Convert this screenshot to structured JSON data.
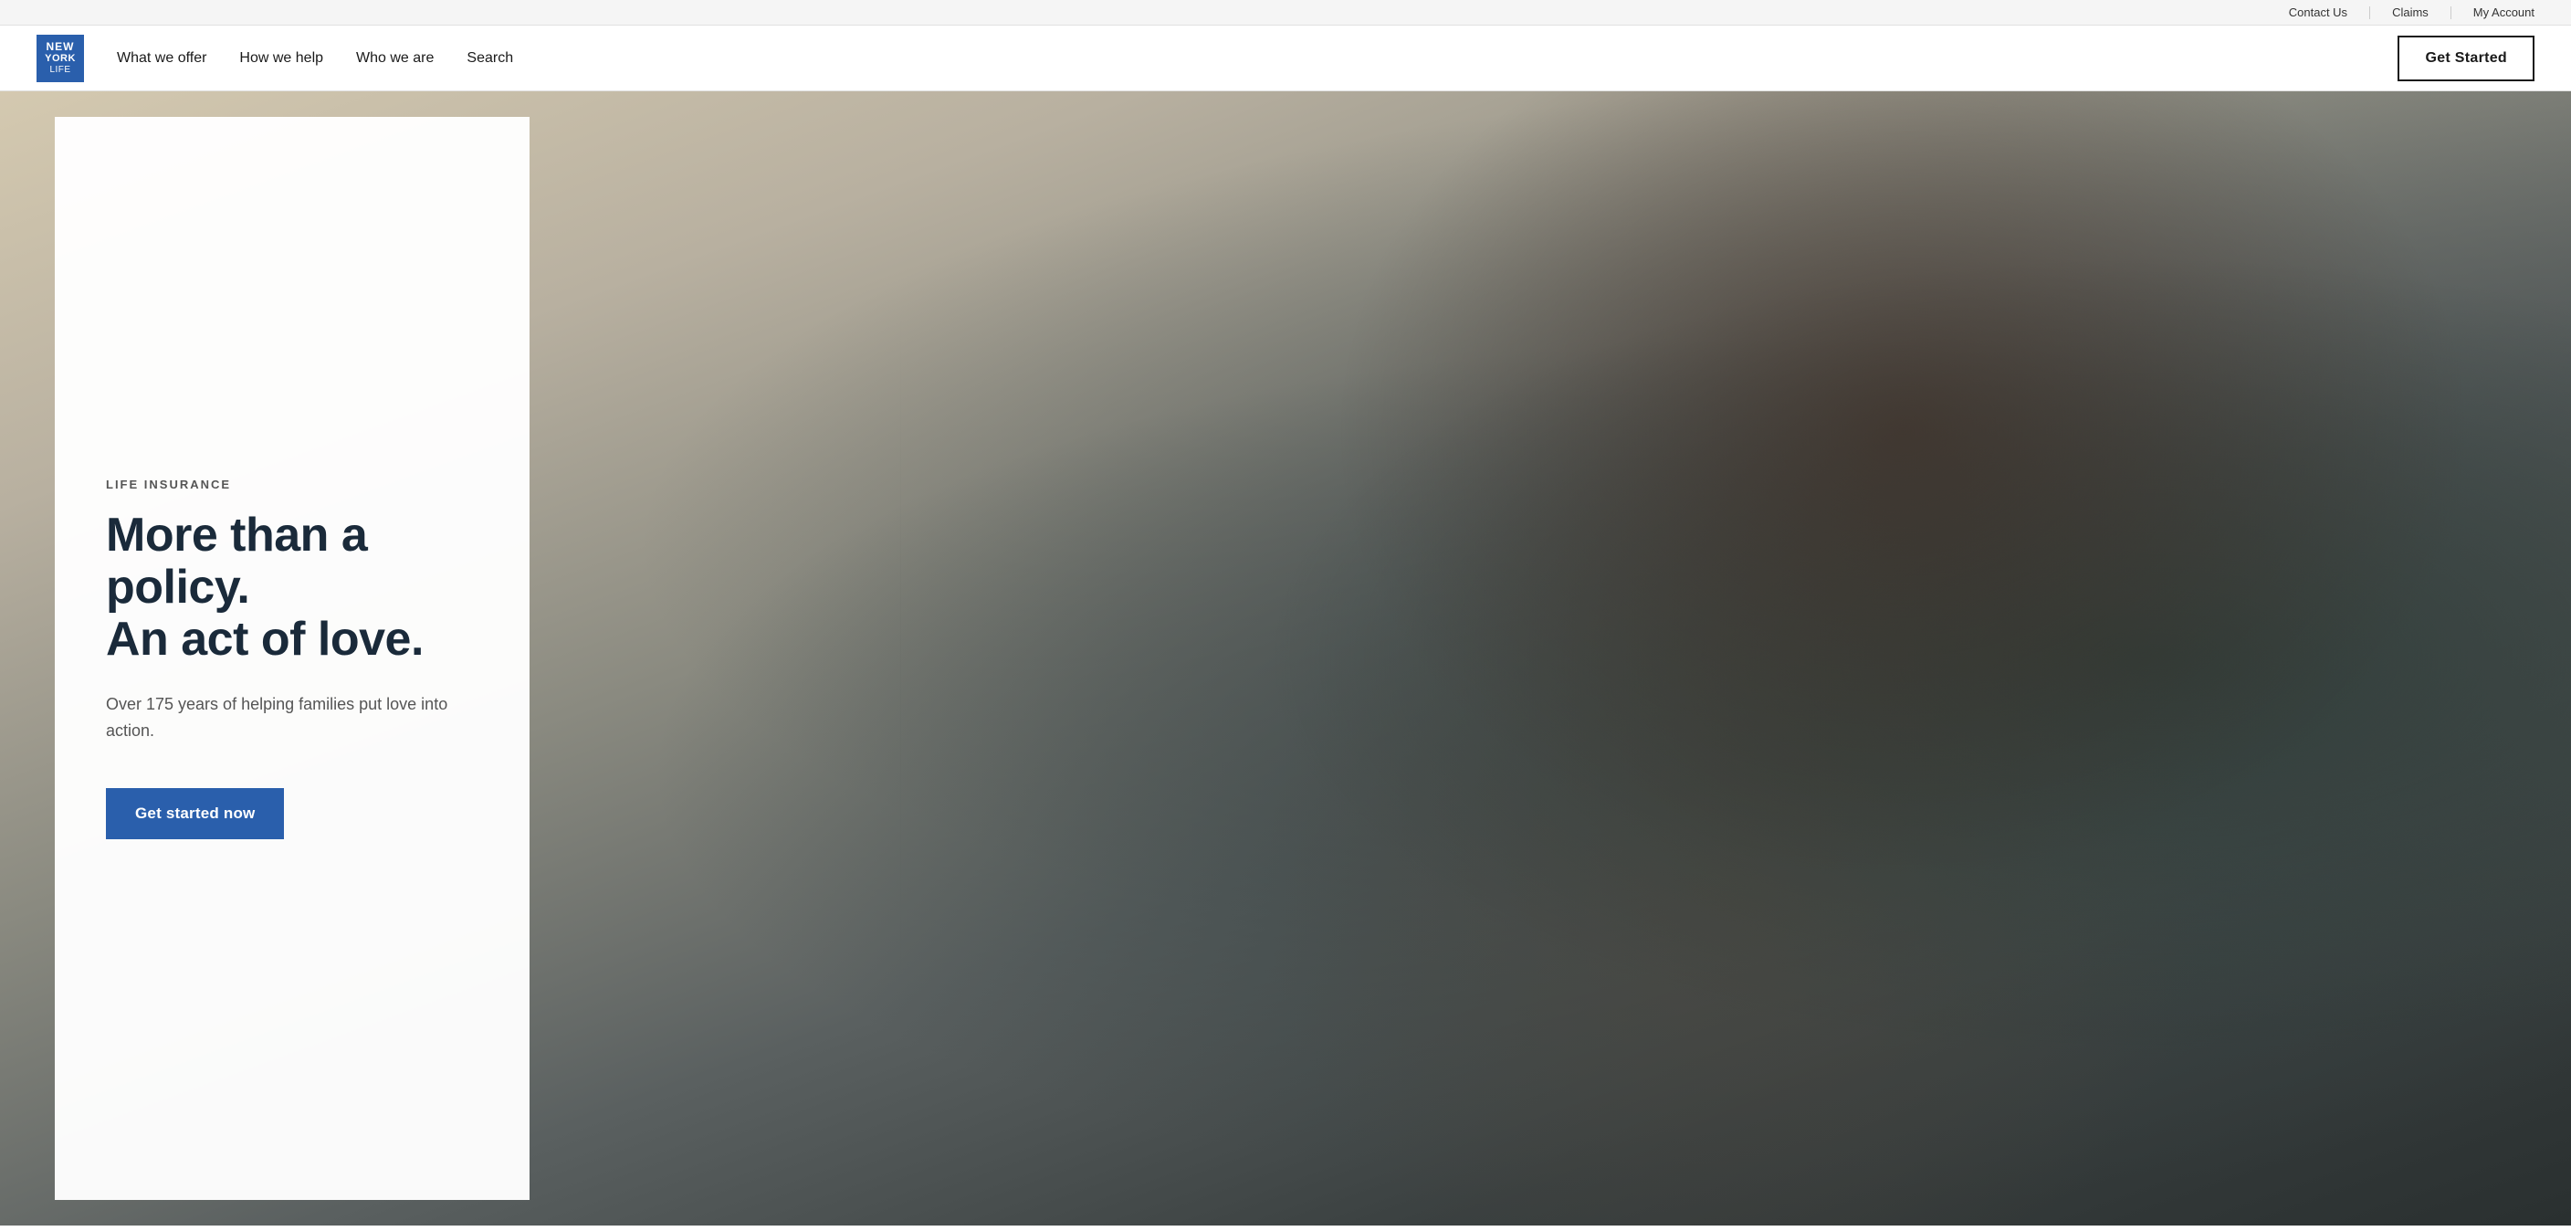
{
  "utility_bar": {
    "contact_us": "Contact Us",
    "claims": "Claims",
    "my_account": "My Account"
  },
  "nav": {
    "logo": {
      "line1": "NEW",
      "line2": "YORK",
      "line3": "LIFE"
    },
    "links": [
      {
        "label": "What we offer",
        "id": "what-we-offer"
      },
      {
        "label": "How we help",
        "id": "how-we-help"
      },
      {
        "label": "Who we are",
        "id": "who-we-are"
      },
      {
        "label": "Search",
        "id": "search"
      }
    ],
    "get_started_label": "Get Started"
  },
  "hero": {
    "eyebrow": "LIFE INSURANCE",
    "headline_line1": "More than a policy.",
    "headline_line2": "An act of love.",
    "subtext": "Over 175 years of helping families put love into action.",
    "cta_label": "Get started now"
  }
}
